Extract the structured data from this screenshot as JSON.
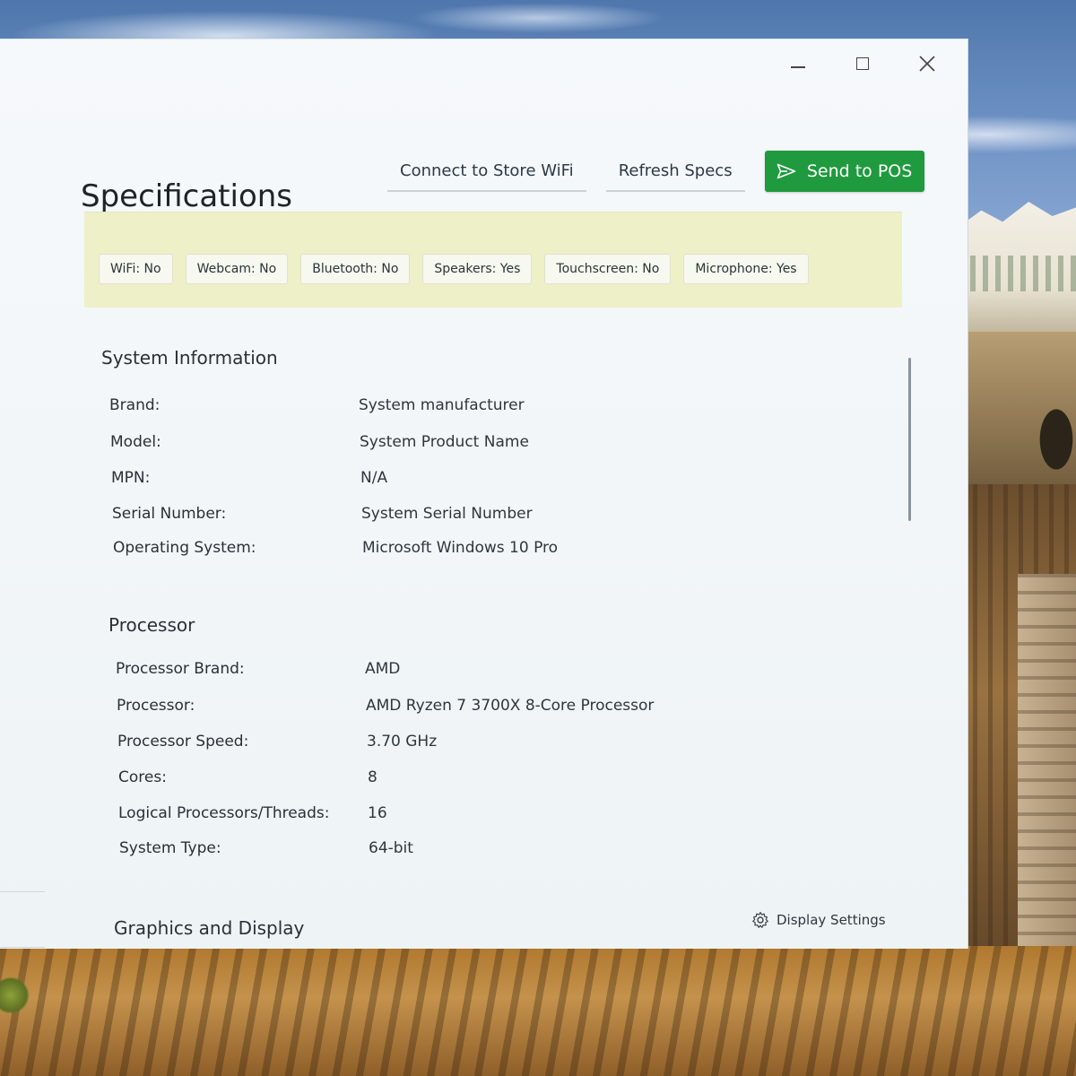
{
  "window": {
    "controls": {
      "minimize": "minimize-icon",
      "maximize": "maximize-icon",
      "close": "close-icon"
    }
  },
  "header": {
    "title": "Specifications",
    "buttons": {
      "connect_wifi": "Connect to Store WiFi",
      "refresh": "Refresh Specs",
      "send": "Send to POS"
    }
  },
  "features": [
    "WiFi: No",
    "Webcam: No",
    "Bluetooth: No",
    "Speakers: Yes",
    "Touchscreen: No",
    "Microphone: Yes"
  ],
  "system": {
    "title": "System Information",
    "rows": [
      {
        "label": "Brand:",
        "value": "System manufacturer"
      },
      {
        "label": "Model:",
        "value": "System Product Name"
      },
      {
        "label": "MPN:",
        "value": "N/A"
      },
      {
        "label": "Serial Number:",
        "value": "System Serial Number"
      },
      {
        "label": "Operating System:",
        "value": "Microsoft Windows 10 Pro"
      }
    ]
  },
  "processor": {
    "title": "Processor",
    "rows": [
      {
        "label": "Processor Brand:",
        "value": "AMD"
      },
      {
        "label": "Processor:",
        "value": "AMD Ryzen 7 3700X 8-Core Processor"
      },
      {
        "label": "Processor Speed:",
        "value": "3.70 GHz"
      },
      {
        "label": "Cores:",
        "value": "8"
      },
      {
        "label": "Logical Processors/Threads:",
        "value": "16"
      },
      {
        "label": "System Type:",
        "value": "64-bit"
      }
    ]
  },
  "graphics": {
    "title": "Graphics and Display",
    "settings_label": "Display Settings"
  },
  "colors": {
    "accent": "#1f9a3e",
    "feature_bar": "#eef0c8"
  }
}
